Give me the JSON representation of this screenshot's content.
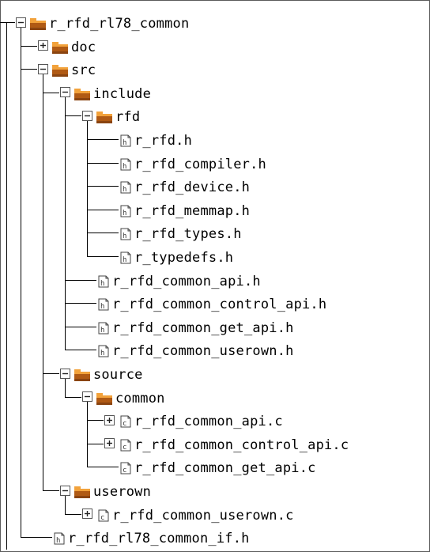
{
  "tree": {
    "items": [
      {
        "label": "r_rfd_rl78_common",
        "type": "folder",
        "state": "expanded",
        "level": 0
      },
      {
        "label": "doc",
        "type": "folder",
        "state": "collapsed",
        "level": 1
      },
      {
        "label": "src",
        "type": "folder",
        "state": "expanded",
        "level": 1
      },
      {
        "label": "include",
        "type": "folder",
        "state": "expanded",
        "level": 2
      },
      {
        "label": "rfd",
        "type": "folder",
        "state": "expanded",
        "level": 3
      },
      {
        "label": "r_rfd.h",
        "type": "header",
        "state": "leaf",
        "level": 4
      },
      {
        "label": "r_rfd_compiler.h",
        "type": "header",
        "state": "leaf",
        "level": 4
      },
      {
        "label": "r_rfd_device.h",
        "type": "header",
        "state": "leaf",
        "level": 4
      },
      {
        "label": "r_rfd_memmap.h",
        "type": "header",
        "state": "leaf",
        "level": 4
      },
      {
        "label": "r_rfd_types.h",
        "type": "header",
        "state": "leaf",
        "level": 4
      },
      {
        "label": "r_typedefs.h",
        "type": "header",
        "state": "leaf",
        "level": 4
      },
      {
        "label": "r_rfd_common_api.h",
        "type": "header",
        "state": "leaf",
        "level": 3
      },
      {
        "label": "r_rfd_common_control_api.h",
        "type": "header",
        "state": "leaf",
        "level": 3
      },
      {
        "label": "r_rfd_common_get_api.h",
        "type": "header",
        "state": "leaf",
        "level": 3
      },
      {
        "label": "r_rfd_common_userown.h",
        "type": "header",
        "state": "leaf",
        "level": 3
      },
      {
        "label": "source",
        "type": "folder",
        "state": "expanded",
        "level": 2
      },
      {
        "label": "common",
        "type": "folder",
        "state": "expanded",
        "level": 3
      },
      {
        "label": "r_rfd_common_api.c",
        "type": "source",
        "state": "collapsed",
        "level": 4
      },
      {
        "label": "r_rfd_common_control_api.c",
        "type": "source",
        "state": "collapsed",
        "level": 4
      },
      {
        "label": "r_rfd_common_get_api.c",
        "type": "source",
        "state": "leaf",
        "level": 4
      },
      {
        "label": "userown",
        "type": "folder",
        "state": "expanded",
        "level": 2
      },
      {
        "label": "r_rfd_common_userown.c",
        "type": "source",
        "state": "collapsed",
        "level": 3
      },
      {
        "label": "r_rfd_rl78_common_if.h",
        "type": "header",
        "state": "leaf",
        "level": 1
      }
    ]
  },
  "colors": {
    "folder_main": "#b05a14",
    "folder_dark": "#8a4410",
    "folder_tab": "#f2a23b",
    "line": "#000000",
    "text": "#000000",
    "border": "#5a5a5a"
  },
  "icons": {
    "folder": "folder-icon",
    "header": "h-file-icon",
    "source": "c-file-icon",
    "expand": "plus-box-icon",
    "collapse": "minus-box-icon"
  }
}
